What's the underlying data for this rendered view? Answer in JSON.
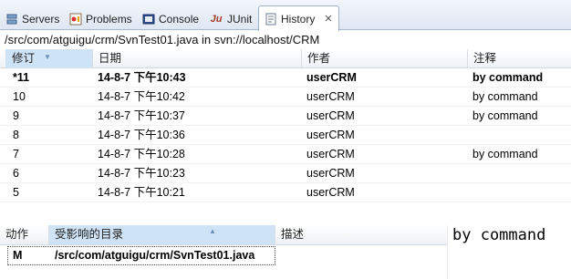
{
  "tabs": [
    {
      "label": "Servers",
      "icon": "servers-icon",
      "active": false
    },
    {
      "label": "Problems",
      "icon": "problems-icon",
      "active": false
    },
    {
      "label": "Console",
      "icon": "console-icon",
      "active": false
    },
    {
      "label": "JUnit",
      "icon": "junit-icon",
      "active": false
    },
    {
      "label": "History",
      "icon": "history-icon",
      "active": true
    }
  ],
  "path": "/src/com/atguigu/crm/SvnTest01.java in svn://localhost/CRM",
  "revisions": {
    "headers": {
      "revision": "修订",
      "date": "日期",
      "author": "作者",
      "comment": "注释"
    },
    "rows": [
      {
        "revision": "*11",
        "date": "14-8-7 下午10:43",
        "author": "userCRM",
        "comment": "by command"
      },
      {
        "revision": "10",
        "date": "14-8-7 下午10:42",
        "author": "userCRM",
        "comment": "by command"
      },
      {
        "revision": "9",
        "date": "14-8-7 下午10:37",
        "author": "userCRM",
        "comment": "by command"
      },
      {
        "revision": "8",
        "date": "14-8-7 下午10:36",
        "author": "userCRM",
        "comment": ""
      },
      {
        "revision": "7",
        "date": "14-8-7 下午10:28",
        "author": "userCRM",
        "comment": "by command"
      },
      {
        "revision": "6",
        "date": "14-8-7 下午10:23",
        "author": "userCRM",
        "comment": ""
      },
      {
        "revision": "5",
        "date": "14-8-7 下午10:21",
        "author": "userCRM",
        "comment": ""
      }
    ]
  },
  "changed_paths": {
    "headers": {
      "action": "动作",
      "affected": "受影响的目录",
      "description": "描述"
    },
    "rows": [
      {
        "action": "M",
        "path": "/src/com/atguigu/crm/SvnTest01.java",
        "description": ""
      }
    ]
  },
  "comment_panel": {
    "text": "by command"
  },
  "colors": {
    "tab_bg": "#dfe7f3",
    "header_selected": "#cfe3f7",
    "sort_indicator": "#6a8fb8"
  }
}
